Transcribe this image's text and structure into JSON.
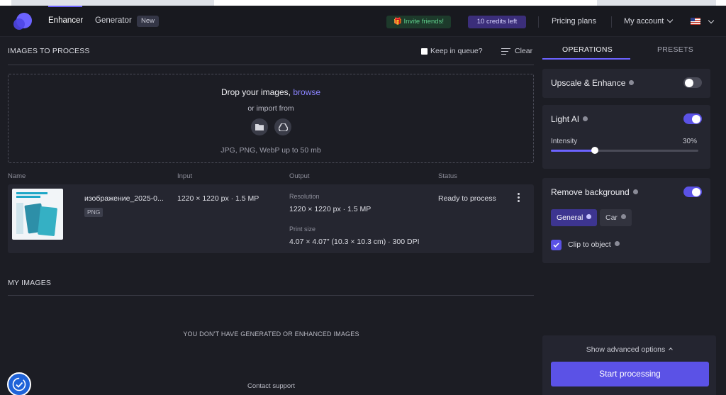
{
  "header": {
    "nav": {
      "enhancer": "Enhancer",
      "generator": "Generator",
      "new_badge": "New"
    },
    "invite": "Invite friends!",
    "credits": "10 credits left",
    "pricing": "Pricing plans",
    "account": "My account"
  },
  "process": {
    "title": "IMAGES TO PROCESS",
    "keep_in_queue": "Keep in queue?",
    "clear": "Clear",
    "dropzone": {
      "title": "Drop your images,",
      "browse": "browse",
      "import_from": "or import from",
      "hint": "JPG, PNG, WebP up to 50 mb",
      "sources": [
        "folder-icon",
        "google-drive-icon"
      ]
    },
    "columns": {
      "name": "Name",
      "input": "Input",
      "output": "Output",
      "status": "Status"
    },
    "file": {
      "name": "изображение_2025-0...",
      "format": "PNG",
      "input": "1220 × 1220 px · 1.5 MP",
      "resolution_label": "Resolution",
      "resolution": "1220 × 1220 px · 1.5 MP",
      "print_label": "Print size",
      "print": "4.07 × 4.07\" (10.3 × 10.3 cm) · 300 DPI",
      "status": "Ready to process"
    }
  },
  "my_images": {
    "title": "MY IMAGES",
    "empty": "YOU DON'T HAVE GENERATED OR ENHANCED IMAGES"
  },
  "contact_support": "Contact support",
  "sidebar": {
    "tabs": {
      "operations": "OPERATIONS",
      "presets": "PRESETS"
    },
    "upscale": {
      "label": "Upscale & Enhance",
      "enabled": false
    },
    "light_ai": {
      "label": "Light AI",
      "enabled": true,
      "intensity_label": "Intensity",
      "intensity": "30%",
      "intensity_value": 0.3
    },
    "remove_bg": {
      "label": "Remove background",
      "enabled": true,
      "modes": [
        "General",
        "Car"
      ],
      "selected_mode": "General",
      "clip_label": "Clip to object",
      "clip_checked": true
    },
    "advanced": "Show advanced options",
    "start": "Start processing"
  },
  "colors": {
    "accent": "#5b52e6",
    "background": "#1c1d24",
    "card": "#252630",
    "invite_text": "#5fd18c"
  }
}
